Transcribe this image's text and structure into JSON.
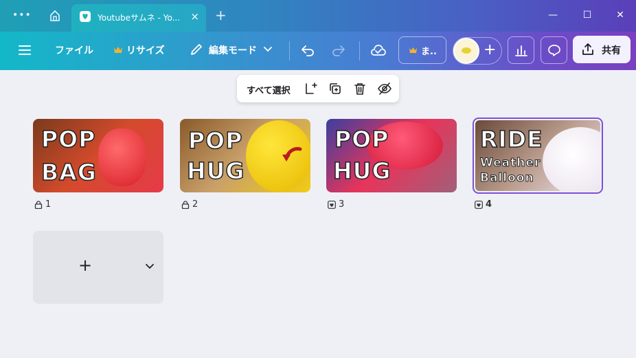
{
  "browser": {
    "tab_title": "Youtubeサムネ - Yo...",
    "tab_close": "×",
    "new_tab": "+",
    "more": "•••",
    "window_controls": {
      "minimize": "—",
      "maximize": "☐",
      "close": "✕"
    }
  },
  "toolbar": {
    "file_label": "ファイル",
    "resize_label": "リサイズ",
    "edit_mode_label": "編集モード",
    "premium_short_label": "ま..",
    "share_label": "共有"
  },
  "context_bar": {
    "select_all_label": "すべて選択"
  },
  "pages": [
    {
      "number": "1",
      "status_icon": "lock-icon",
      "lines": [
        "POP",
        "BAG"
      ],
      "colors": [
        "#7b3a1c",
        "#d44a2c",
        "#e63a4a"
      ]
    },
    {
      "number": "2",
      "status_icon": "lock-icon",
      "lines": [
        "POP",
        "HUG"
      ],
      "colors": [
        "#8a5a2a",
        "#c9a06a",
        "#f2cc12"
      ]
    },
    {
      "number": "3",
      "status_icon": "heart-icon",
      "lines": [
        "POP",
        "HUG"
      ],
      "colors": [
        "#3a3fa0",
        "#e8345a",
        "#a0607a"
      ]
    },
    {
      "number": "4",
      "status_icon": "heart-icon",
      "lines": [
        "RIDE",
        "Weather",
        "Balloon"
      ],
      "colors": [
        "#6a4a3a",
        "#b89a8a",
        "#efe6f2"
      ],
      "selected": true
    }
  ],
  "add_page": {
    "plus": "+",
    "chevron": "⌄"
  },
  "colors": {
    "accent": "#7d4fd8",
    "toolbar_start": "#13b8c8",
    "toolbar_end": "#7a3fc0"
  }
}
